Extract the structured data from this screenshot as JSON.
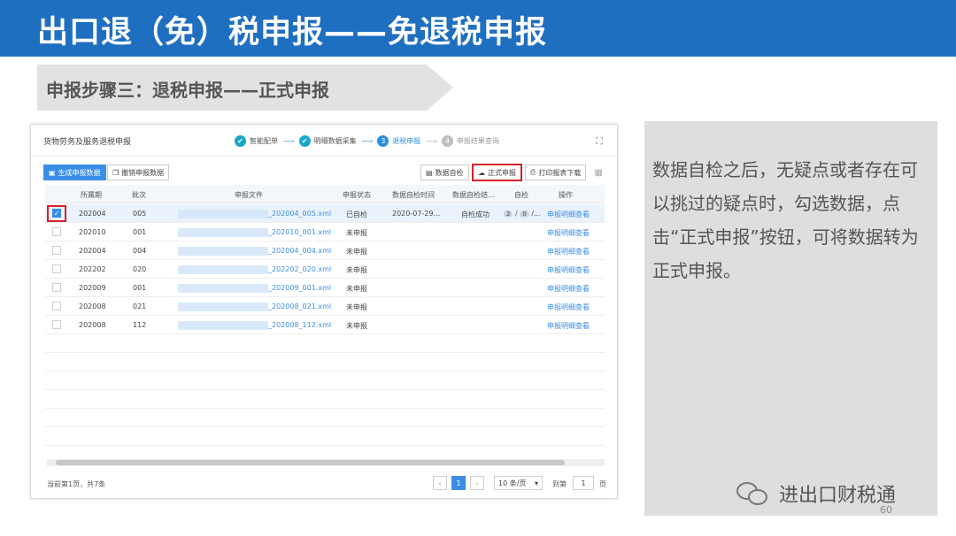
{
  "header": {
    "title": "出口退（免）税申报——免退税申报"
  },
  "step_banner": {
    "text": "申报步骤三：退税申报——正式申报"
  },
  "panel": {
    "title": "货物劳务及服务退税申报",
    "steps": [
      {
        "label": "智能配单",
        "state": "done",
        "icon": "✔"
      },
      {
        "label": "明细数据采集",
        "state": "done",
        "icon": "✔"
      },
      {
        "label": "退税申报",
        "state": "current",
        "icon": "3"
      },
      {
        "label": "申报结果查询",
        "state": "todo",
        "icon": "4"
      }
    ],
    "toolbar": {
      "generate": "生成申报数据",
      "revoke": "撤销申报数据",
      "self_check": "数据自检",
      "formal_submit": "正式申报",
      "print": "打印报表下载"
    },
    "table": {
      "headers": [
        "所属期",
        "批次",
        "申报文件",
        "申报状态",
        "数据自检时间",
        "数据自检结...",
        "自检",
        "操作"
      ],
      "rows": [
        {
          "period": "202004",
          "batch": "005",
          "file": "_202004_005.xml",
          "status": "已自检",
          "check_time": "2020-07-29...",
          "check_result": "自检成功",
          "counts": [
            "2",
            "0"
          ],
          "op": "申报明细查看",
          "checked": true
        },
        {
          "period": "202010",
          "batch": "001",
          "file": "_202010_001.xml",
          "status": "未申报",
          "check_time": "",
          "check_result": "",
          "op": "申报明细查看",
          "checked": false
        },
        {
          "period": "202004",
          "batch": "004",
          "file": "_202004_004.xml",
          "status": "未申报",
          "check_time": "",
          "check_result": "",
          "op": "申报明细查看",
          "checked": false
        },
        {
          "period": "202202",
          "batch": "020",
          "file": "_202202_020.xml",
          "status": "未申报",
          "check_time": "",
          "check_result": "",
          "op": "申报明细查看",
          "checked": false
        },
        {
          "period": "202009",
          "batch": "001",
          "file": "_202009_001.xml",
          "status": "未申报",
          "check_time": "",
          "check_result": "",
          "op": "申报明细查看",
          "checked": false
        },
        {
          "period": "202008",
          "batch": "021",
          "file": "_202008_021.xml",
          "status": "未申报",
          "check_time": "",
          "check_result": "",
          "op": "申报明细查看",
          "checked": false
        },
        {
          "period": "202008",
          "batch": "112",
          "file": "_202008_112.xml",
          "status": "未申报",
          "check_time": "",
          "check_result": "",
          "op": "申报明细查看",
          "checked": false
        }
      ]
    },
    "footer": {
      "info": "当前第1页，共7条",
      "current_page": "1",
      "page_size": "10 条/页",
      "goto_label": "到第",
      "goto_value": "1",
      "page_suffix": "页"
    }
  },
  "description": "数据自检之后，无疑点或者存在可以挑过的疑点时，勾选数据，点击“正式申报”按钮，可将数据转为正式申报。",
  "watermark": {
    "name": "进出口财税通"
  },
  "page_number": "60",
  "colors": {
    "header_blue": "#1f6fc0",
    "accent_blue": "#3a8ee6",
    "highlight_red": "#d9202a"
  }
}
